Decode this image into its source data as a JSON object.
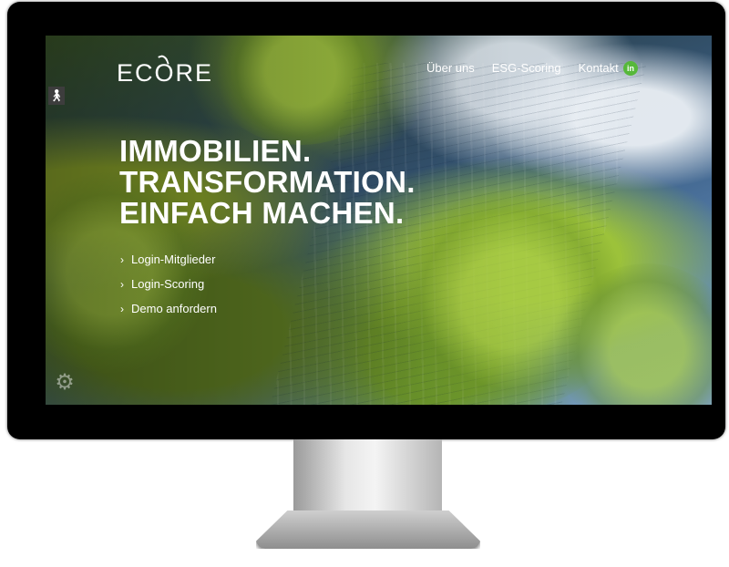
{
  "header": {
    "logo_text": "ECORE",
    "nav": [
      "Über uns",
      "ESG-Scoring",
      "Kontakt"
    ],
    "social_icon": "linkedin-icon",
    "social_label": "in",
    "accent_color": "#56b83a"
  },
  "hero": {
    "headline": [
      "IMMOBILIEN.",
      "TRANSFORMATION.",
      "EINFACH MACHEN."
    ],
    "links": [
      "Login-Mitglieder",
      "Login-Scoring",
      "Demo anfordern"
    ]
  },
  "icons": {
    "accessibility": "accessibility-icon",
    "cookie": "cookie-settings-icon"
  }
}
